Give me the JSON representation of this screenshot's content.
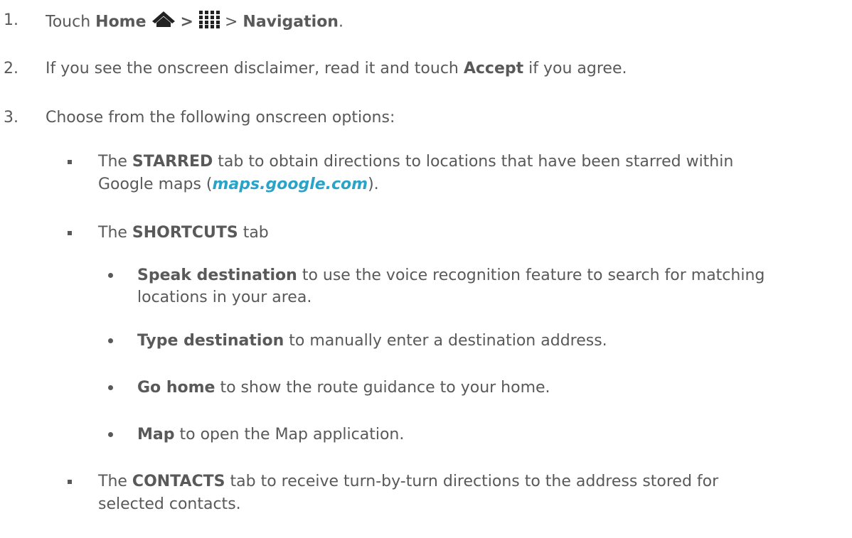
{
  "steps": [
    {
      "number": "1.",
      "text_touch": "Touch",
      "home": "Home",
      "sep1": ">",
      "sep2": ">",
      "navigation": "Navigation",
      "end": "."
    },
    {
      "number": "2.",
      "pre": "If you see the onscreen disclaimer, read it and touch",
      "accept": "Accept",
      "post": "if you agree."
    },
    {
      "number": "3.",
      "text": "Choose from the following onscreen options:"
    }
  ],
  "options": {
    "starred": {
      "pre": "The",
      "tab": "STARRED",
      "post": "tab to obtain directions to locations that have been starred within",
      "line2_pre": "Google maps (",
      "link": "maps.google.com",
      "line2_post": ")."
    },
    "shortcuts": {
      "pre": "The",
      "tab": "SHORTCUTS",
      "post": "tab",
      "items": [
        {
          "label": "Speak destination",
          "text": "to use the voice recognition feature to search for matching",
          "text2": "locations in your area."
        },
        {
          "label": "Type destination",
          "text": "to manually enter a destination address."
        },
        {
          "label": "Go home",
          "text": "to show the route guidance to your home."
        },
        {
          "label": "Map",
          "text": "to open the Map application."
        }
      ]
    },
    "contacts": {
      "pre": "The",
      "tab": "CONTACTS",
      "post": "tab to receive turn-by-turn directions to the address stored for",
      "line2": "selected contacts."
    }
  },
  "icons": {
    "home": "home-icon",
    "apps": "apps-grid-icon"
  },
  "colors": {
    "text": "#595959",
    "link": "#2aa3c9"
  }
}
